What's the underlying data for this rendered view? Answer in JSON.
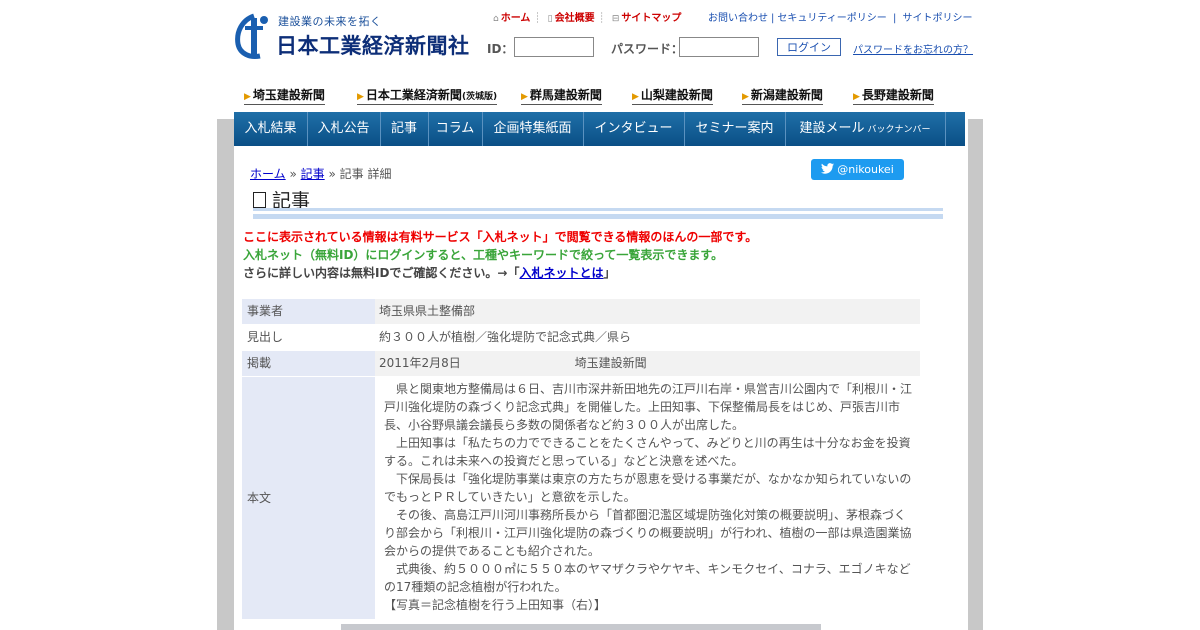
{
  "header": {
    "tagline": "建設業の未来を拓く",
    "company_name": "日本工業経済新聞社",
    "top_links": [
      {
        "icon": "home-icon",
        "label": "ホーム"
      },
      {
        "icon": "document-icon",
        "label": "会社概要"
      },
      {
        "icon": "sitemap-icon",
        "label": "サイトマップ"
      }
    ],
    "right_links": [
      "お問い合わせ",
      "セキュリティーポリシー",
      "サイトポリシー"
    ],
    "login": {
      "id_label": "ID：",
      "password_label": "パスワード：",
      "button_label": "ログイン",
      "forgot_label": "パスワードをお忘れの方？"
    }
  },
  "papers": [
    "埼玉建設新聞",
    "日本工業経済新聞",
    "(茨城版)",
    "群馬建設新聞",
    "山梨建設新聞",
    "新潟建設新聞",
    "長野建設新聞"
  ],
  "nav": {
    "items": [
      "入札結果",
      "入札公告",
      "記事",
      "コラム",
      "企画特集紙面",
      "インタビュー",
      "セミナー案内",
      "建設メール"
    ],
    "backnumber": "バックナンバー"
  },
  "breadcrumb": {
    "home": "ホーム",
    "sep": "»",
    "article": "記事",
    "current": "記事 詳細"
  },
  "twitter_label": "@nikoukei",
  "section_title": "記事",
  "notice": {
    "line1": "ここに表示されている情報は有料サービス「入札ネット」で閲覧できる情報のほんの一部です。",
    "line2": "入札ネット（無料ID）にログインすると、工種やキーワードで絞って一覧表示できます。",
    "line3_prefix": "さらに詳しい内容は無料IDでご確認ください。→「",
    "line3_link": "入札ネットとは",
    "line3_suffix": "」"
  },
  "article": {
    "labels": {
      "org": "事業者",
      "headline": "見出し",
      "published": "掲載",
      "body": "本文"
    },
    "org": "埼玉県県土整備部",
    "headline": "約３００人が植樹／強化堤防で記念式典／県ら",
    "date": "2011年2月8日",
    "paper": "埼玉建設新聞",
    "body": [
      "　県と関東地方整備局は６日、吉川市深井新田地先の江戸川右岸・県営吉川公園内で「利根川・江戸川強化堤防の森づくり記念式典」を開催した。上田知事、下保整備局長をはじめ、戸張吉川市長、小谷野県議会議長ら多数の関係者など約３００人が出席した。",
      "　上田知事は「私たちの力でできることをたくさんやって、みどりと川の再生は十分なお金を投資する。これは未来への投資だと思っている」などと決意を述べた。",
      "　下保局長は「強化堤防事業は東京の方たちが恩恵を受ける事業だが、なかなか知られていないのでもっとＰＲしていきたい」と意欲を示した。",
      "　その後、高島江戸川河川事務所長から「首都圏氾濫区域堤防強化対策の概要説明」、茅根森づくり部会から「利根川・江戸川強化堤防の森づくりの概要説明」が行われ、植樹の一部は県造園業協会からの提供であることも紹介された。",
      "　式典後、約５０００㎡に５５０本のヤマザクラやケヤキ、キンモクセイ、コナラ、エゴノキなどの17種類の記念植樹が行われた。",
      "【写真＝記念植樹を行う上田知事（右）】"
    ]
  },
  "colors": {
    "nav": "#0a4f86",
    "brand": "#0d2e78",
    "red": "#e00",
    "green": "#3aa53a",
    "twitter": "#1d9bf0"
  }
}
